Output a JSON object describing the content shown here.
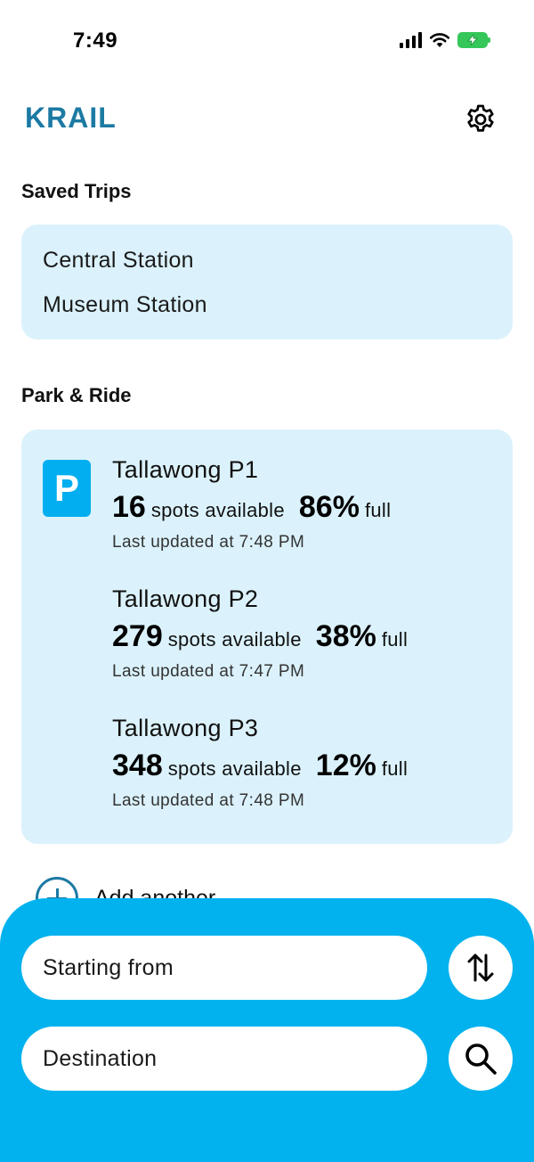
{
  "status_bar": {
    "time": "7:49",
    "battery_color": "#35c759"
  },
  "header": {
    "app_title": "KRAIL",
    "settings_icon": "gear-icon",
    "accent_color": "#1c7aa3"
  },
  "saved_trips": {
    "heading": "Saved Trips",
    "items": [
      {
        "label": "Central Station"
      },
      {
        "label": "Museum Station"
      }
    ]
  },
  "park_ride": {
    "heading": "Park & Ride",
    "badge_letter": "P",
    "badge_color": "#02aeef",
    "spots_label": "spots available",
    "full_label": "full",
    "entries": [
      {
        "name": "Tallawong P1",
        "spots": "16",
        "percent_full": "86%",
        "updated": "Last updated at 7:48 PM"
      },
      {
        "name": "Tallawong P2",
        "spots": "279",
        "percent_full": "38%",
        "updated": "Last updated at 7:47 PM"
      },
      {
        "name": "Tallawong P3",
        "spots": "348",
        "percent_full": "12%",
        "updated": "Last updated at 7:48 PM"
      }
    ],
    "add_label": "Add another"
  },
  "search": {
    "from_placeholder": "Starting from",
    "to_placeholder": "Destination",
    "swap_icon": "swap-vertical-icon",
    "search_icon": "search-icon",
    "sheet_color": "#02b2ee"
  }
}
